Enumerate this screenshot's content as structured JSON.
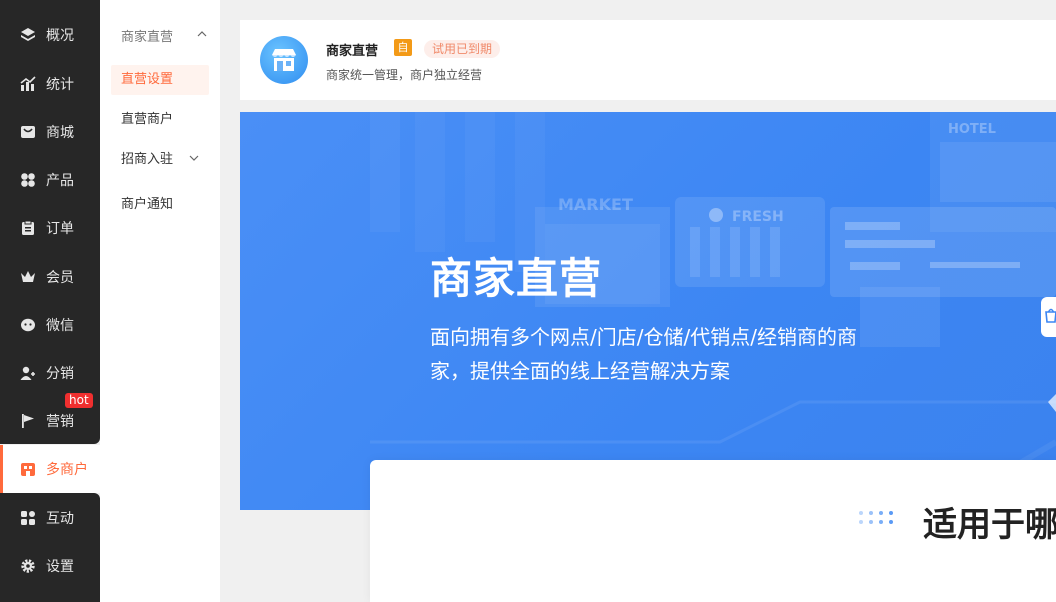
{
  "nav": {
    "items": [
      {
        "label": "概况",
        "icon": "layers-icon"
      },
      {
        "label": "统计",
        "icon": "chart-icon"
      },
      {
        "label": "商城",
        "icon": "shop-icon"
      },
      {
        "label": "产品",
        "icon": "grid-icon"
      },
      {
        "label": "订单",
        "icon": "clipboard-icon"
      },
      {
        "label": "会员",
        "icon": "crown-icon"
      },
      {
        "label": "微信",
        "icon": "wechat-icon"
      },
      {
        "label": "分销",
        "icon": "users-icon"
      },
      {
        "label": "营销",
        "icon": "flag-icon"
      },
      {
        "label": "多商户",
        "icon": "store-icon"
      },
      {
        "label": "互动",
        "icon": "apps-icon"
      },
      {
        "label": "设置",
        "icon": "gear-icon"
      }
    ],
    "hot_badge": "hot"
  },
  "subnav": {
    "header": "商家直营",
    "items": [
      "直营设置",
      "直营商户",
      "招商入驻",
      "商户通知"
    ]
  },
  "card": {
    "title": "商家直营",
    "self_badge": "自",
    "trial_badge": "试用已到期",
    "desc": "商家统一管理，商户独立经营"
  },
  "banner": {
    "title": "商家直营",
    "desc": "面向拥有多个网点/门店/仓储/代销点/经销商的商家，提供全面的线上经营解决方案",
    "signs": [
      "MARKET",
      "FRESH",
      "HOTEL"
    ]
  },
  "panel": {
    "title": "适用于哪"
  },
  "colors": {
    "accent": "#ff6a3c",
    "nav_bg": "#272727",
    "banner_blue": "#3c86f3"
  }
}
